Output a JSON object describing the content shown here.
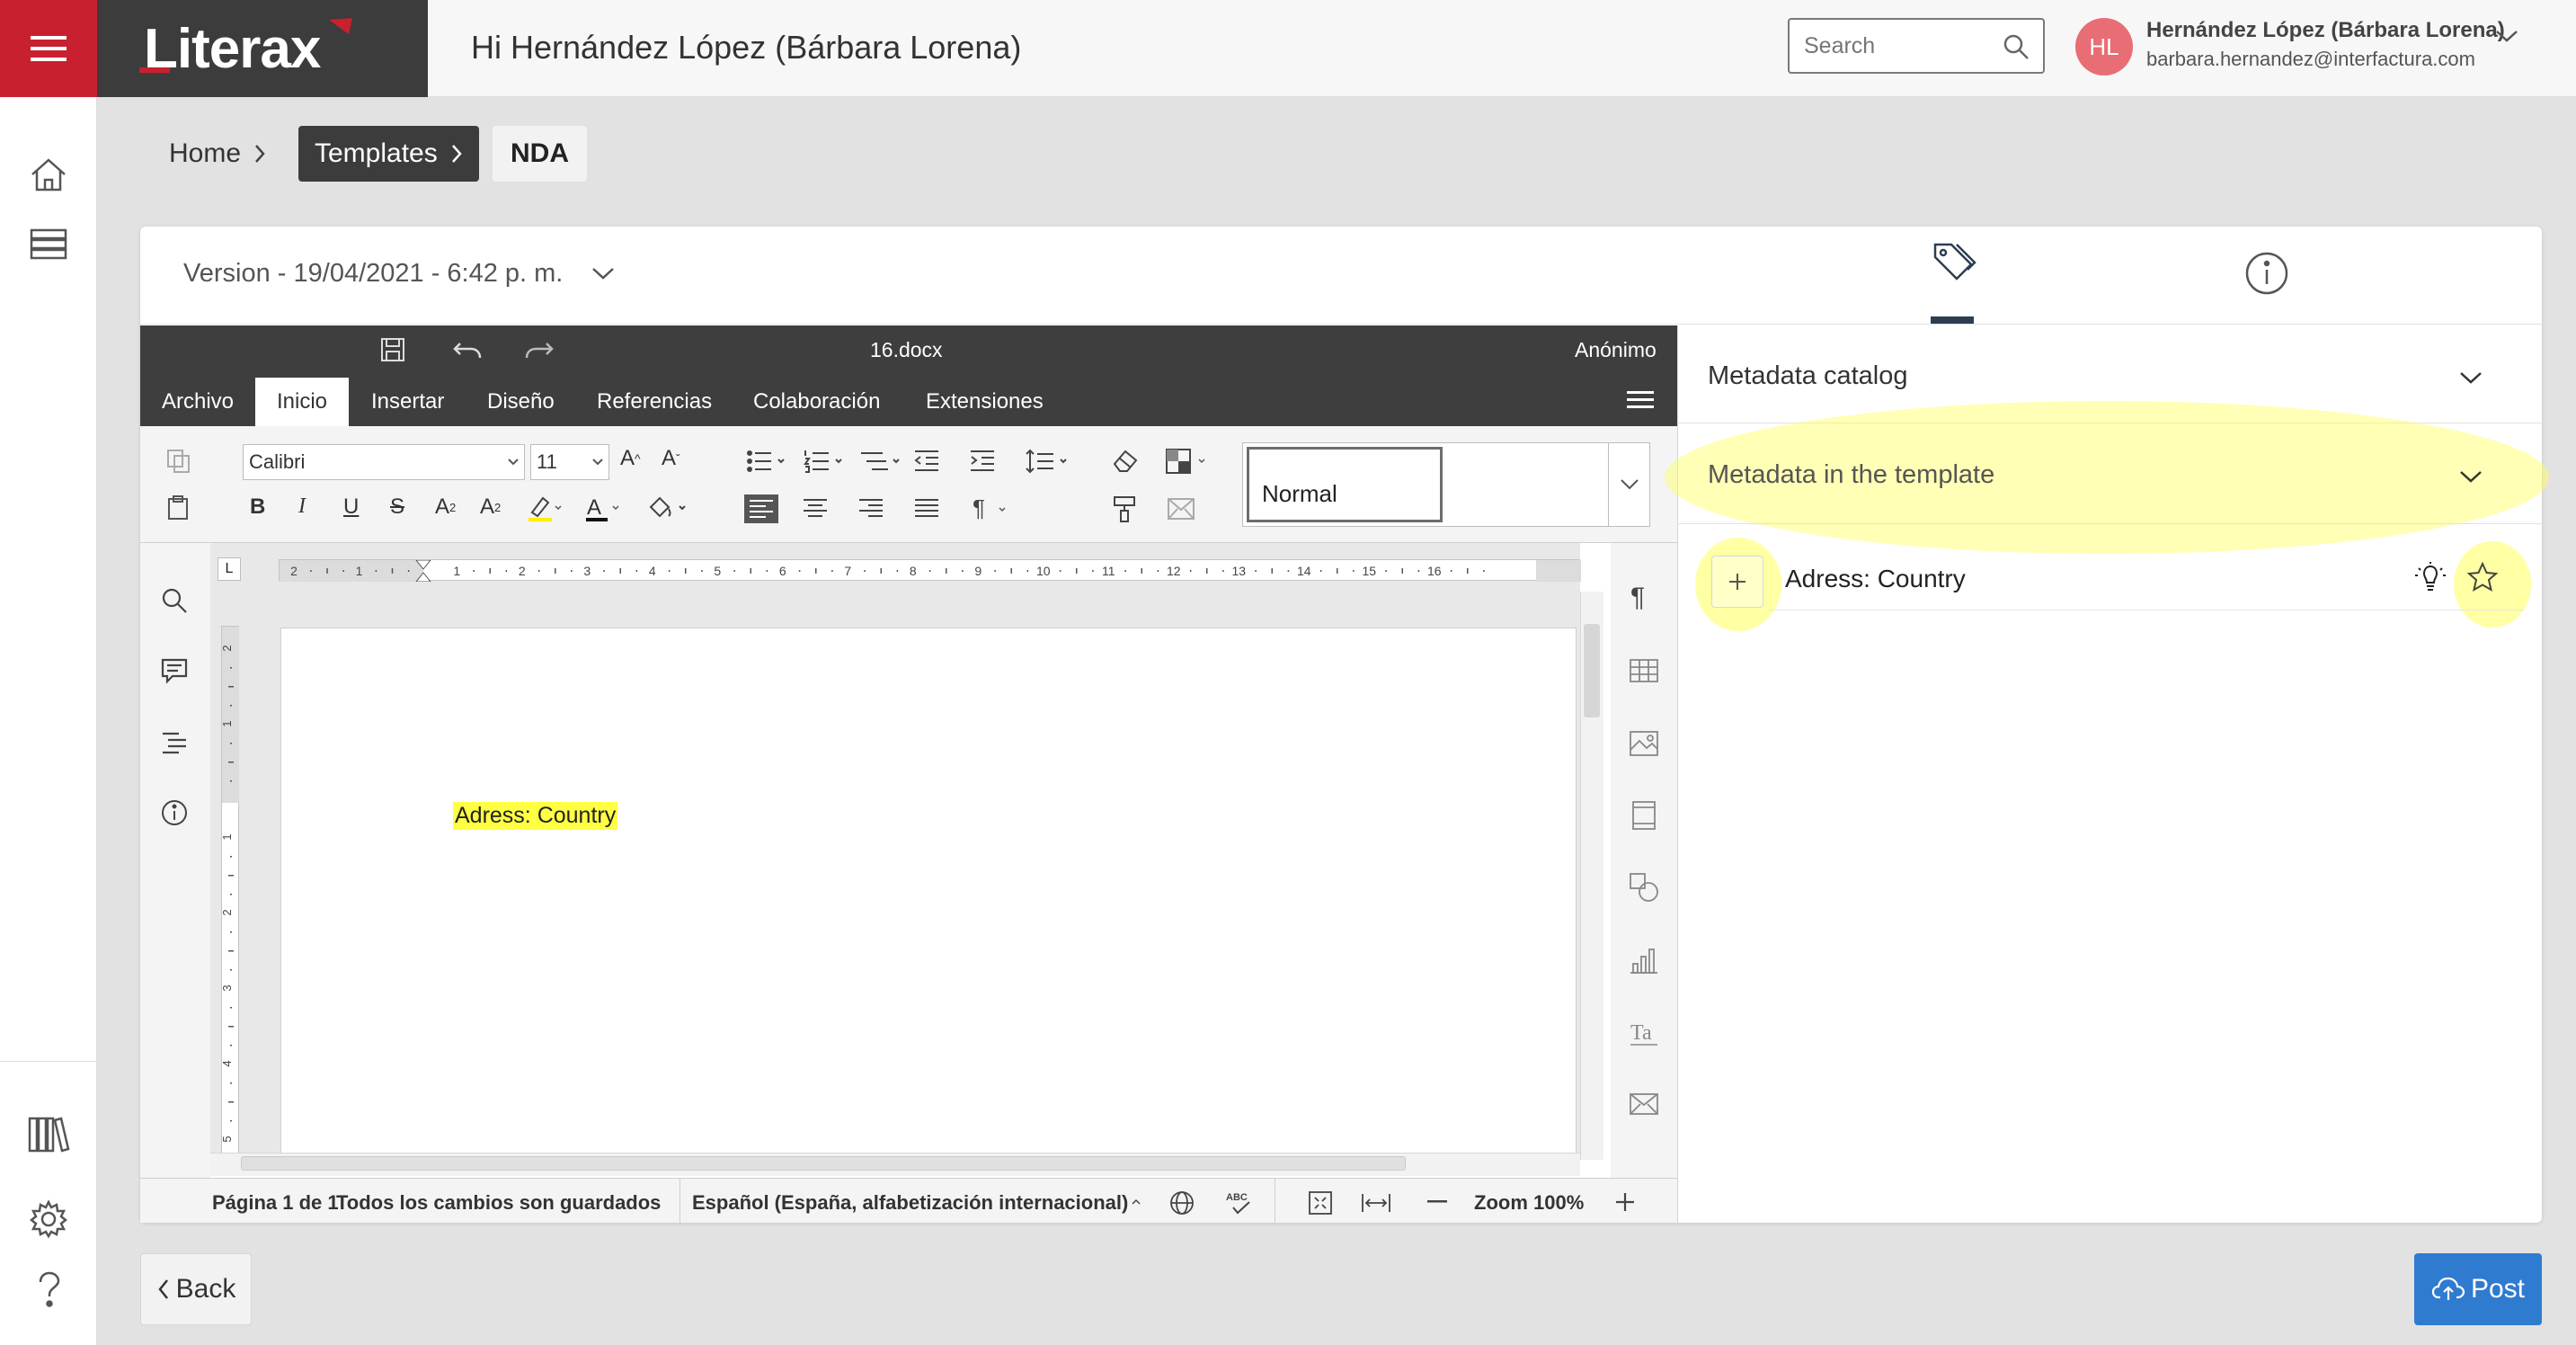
{
  "app": {
    "logo": "Literax"
  },
  "header": {
    "greeting": "Hi Hernández López (Bárbara Lorena)",
    "search_placeholder": "Search",
    "avatar_initials": "HL",
    "user_name": "Hernández López (Bárbara Lorena)",
    "user_email": "barbara.hernandez@interfactura.com"
  },
  "breadcrumb": {
    "home": "Home",
    "templates": "Templates",
    "current": "NDA"
  },
  "card": {
    "version": "Version - 19/04/2021 - 6:42 p. m.",
    "tabs": [
      {
        "icon": "tags-icon"
      },
      {
        "icon": "info-icon"
      }
    ]
  },
  "editor": {
    "filename": "16.docx",
    "user": "Anónimo",
    "menu_tabs": [
      "Archivo",
      "Inicio",
      "Insertar",
      "Diseño",
      "Referencias",
      "Colaboración",
      "Extensiones"
    ],
    "active_tab": "Inicio",
    "font_name": "Calibri",
    "font_size": "11",
    "style_name": "Normal",
    "document_text": "Adress: Country",
    "ruler_numbers": [
      "2",
      "1",
      "1",
      "2",
      "3",
      "4",
      "5",
      "6",
      "7",
      "8",
      "9",
      "10",
      "11",
      "12",
      "13",
      "14",
      "15",
      "16"
    ],
    "vruler_numbers": [
      "2",
      "1",
      "1",
      "2",
      "3",
      "4",
      "5"
    ],
    "status": {
      "page": "Página 1 de 1",
      "saved": "Todos los cambios son guardados",
      "language": "Español (España, alfabetización internacional)",
      "zoom": "Zoom 100%"
    }
  },
  "panel": {
    "catalog_label": "Metadata catalog",
    "template_label": "Metadata in the template",
    "metadata_items": [
      {
        "label": "Adress: Country"
      }
    ]
  },
  "footer": {
    "back": "Back",
    "post": "Post"
  },
  "colors": {
    "brand_red": "#c8202f",
    "dark": "#3c3c3c",
    "post_blue": "#2f7bd0",
    "highlight_yellow": "#ffff44"
  }
}
